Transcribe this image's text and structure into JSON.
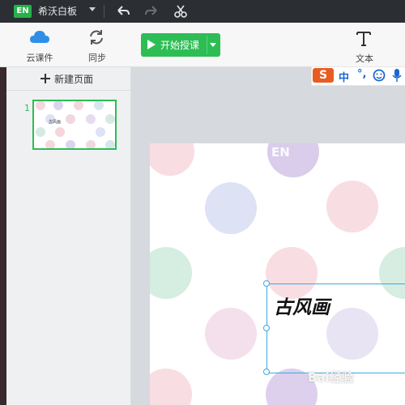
{
  "titlebar": {
    "logo_text": "EN",
    "app_title": "希沃白板"
  },
  "toolbar": {
    "cloud_label": "云课件",
    "sync_label": "同步",
    "start_label": "开始授课",
    "text_label": "文本"
  },
  "sidebar": {
    "new_page_label": "新建页面",
    "pages": [
      {
        "number": "1",
        "thumb_text": "古风画"
      }
    ]
  },
  "ime": {
    "logo": "S",
    "lang": "中",
    "punct": "°,"
  },
  "canvas": {
    "title": "古风画",
    "watermark_logo": "EN"
  },
  "watermark": "Bai经验",
  "colors": {
    "accent": "#2dbd55",
    "titlebar": "#2b2e33",
    "selection": "#3ea8e0"
  }
}
